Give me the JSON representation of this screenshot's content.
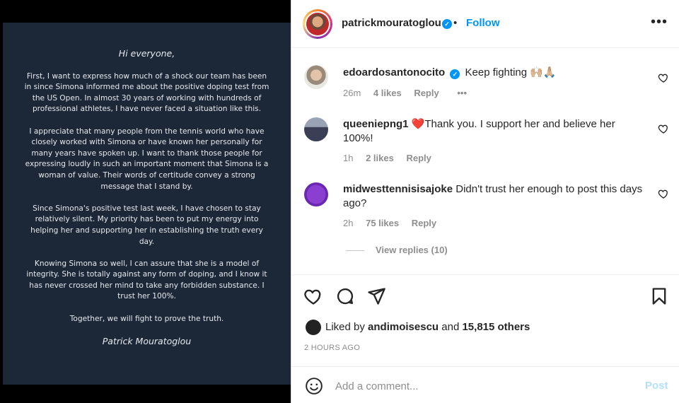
{
  "post_image": {
    "greeting": "Hi everyone,",
    "paragraphs": [
      "First, I want to express how much of a shock our team has been in since Simona informed me about the positive doping test from the US Open. In almost 30 years of working with hundreds of professional athletes, I have never faced a situation like this.",
      "I appreciate that many people from the tennis world who have closely worked with Simona or have known her personally for many years have spoken up. I want to thank those people for expressing loudly in such an important moment that Simona is a woman of value. Their words of certitude convey a strong message that I stand by.",
      "Since Simona's positive test last week, I have chosen to stay relatively silent. My priority has been to put my energy into helping her and supporting her in establishing the truth every day.",
      "Knowing Simona so well, I can assure that she is a model of integrity. She is totally against any form of doping, and I know it has never crossed her mind to take any forbidden substance. I trust her 100%.",
      "Together, we will fight to prove the truth."
    ],
    "signature": "Patrick Mouratoglou"
  },
  "header": {
    "username": "patrickmouratoglou",
    "separator": "•",
    "follow_label": "Follow",
    "more_icon": "more-horizontal-icon"
  },
  "comments": [
    {
      "username": "edoardosantonocito",
      "verified": true,
      "text": "Keep fighting 🙌🏼🙏🏼",
      "time": "26m",
      "likes": "4 likes",
      "reply": "Reply",
      "more": "•••"
    },
    {
      "username": "queeniepng1",
      "verified": false,
      "text": "❤️Thank you. I support her and believe her 100%!",
      "time": "1h",
      "likes": "2 likes",
      "reply": "Reply"
    },
    {
      "username": "midwesttennisisajoke",
      "verified": false,
      "text": "Didn't trust her enough to post this days ago?",
      "time": "2h",
      "likes": "75 likes",
      "reply": "Reply"
    }
  ],
  "view_replies": "View replies (10)",
  "actions": {
    "like_icon": "heart-icon",
    "comment_icon": "comment-icon",
    "share_icon": "send-icon",
    "save_icon": "bookmark-icon"
  },
  "liked_by": {
    "prefix": "Liked by",
    "user": "andimoisescu",
    "and": "and",
    "others": "15,815 others"
  },
  "time_ago": "2 HOURS AGO",
  "add_comment": {
    "placeholder": "Add a comment...",
    "post_label": "Post"
  },
  "colors": {
    "accent": "#0095f6",
    "image_bg": "#1c2838",
    "muted": "#8e8e8e"
  }
}
